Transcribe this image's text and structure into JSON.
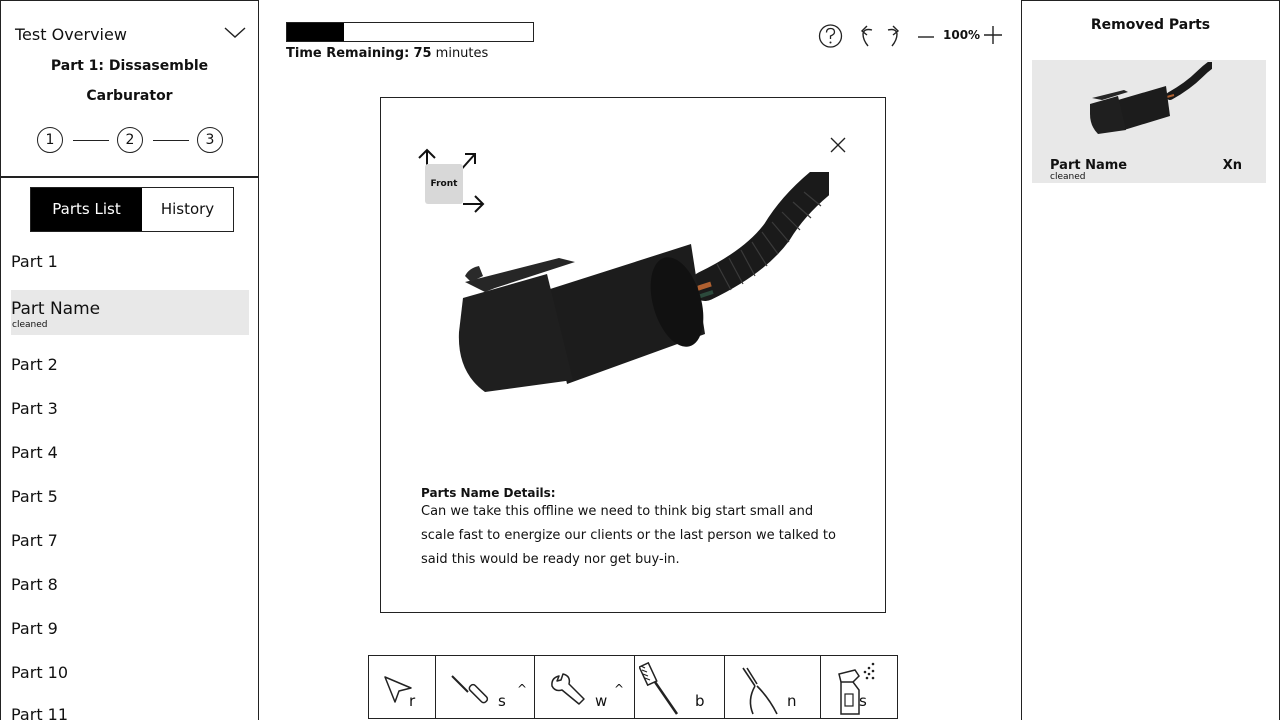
{
  "overview": {
    "heading": "Test Overview",
    "part_title_line1": "Part 1: Dissasemble",
    "part_title_line2": "Carburator",
    "steps": [
      "1",
      "2",
      "3"
    ]
  },
  "tabs": {
    "parts_list": "Parts List",
    "history": "History",
    "active": "parts_list"
  },
  "parts": {
    "items": [
      "Part 1",
      "Part 2",
      "Part 3",
      "Part 4",
      "Part 5",
      "Part 7",
      "Part 8",
      "Part 9",
      "Part 10",
      "Part 11"
    ],
    "selected": {
      "name": "Part Name",
      "status": "cleaned"
    }
  },
  "progress": {
    "fraction": 0.23
  },
  "timer": {
    "label": "Time Remaining:",
    "value": "75",
    "unit": "minutes"
  },
  "topbar": {
    "zoom": "100%",
    "icons": [
      "help-icon",
      "undo-icon",
      "redo-icon",
      "zoom-out-icon",
      "zoom-in-icon"
    ]
  },
  "modal": {
    "orientation_label": "Front",
    "details_title": "Parts Name Details:",
    "details_body": "Can we take this offline we need to think big start small and scale fast to energize our clients or the last person we talked to said this would be ready nor get buy-in."
  },
  "toolbar": {
    "tools": [
      {
        "name": "pointer",
        "key": "r",
        "caret": ""
      },
      {
        "name": "screwdriver",
        "key": "s",
        "caret": "^"
      },
      {
        "name": "wrench",
        "key": "w",
        "caret": "^"
      },
      {
        "name": "brush",
        "key": "b",
        "caret": ""
      },
      {
        "name": "needle-nose-pliers",
        "key": "n",
        "caret": ""
      },
      {
        "name": "spray-bottle",
        "key": "s",
        "caret": ""
      }
    ]
  },
  "removed": {
    "title": "Removed Parts",
    "items": [
      {
        "name": "Part Name",
        "status": "cleaned",
        "qty": "Xn"
      }
    ]
  },
  "colors": {
    "ink": "#111111",
    "highlight": "#e8e8e8",
    "active_tab": "#000000",
    "front_box": "#d8d8d8"
  }
}
